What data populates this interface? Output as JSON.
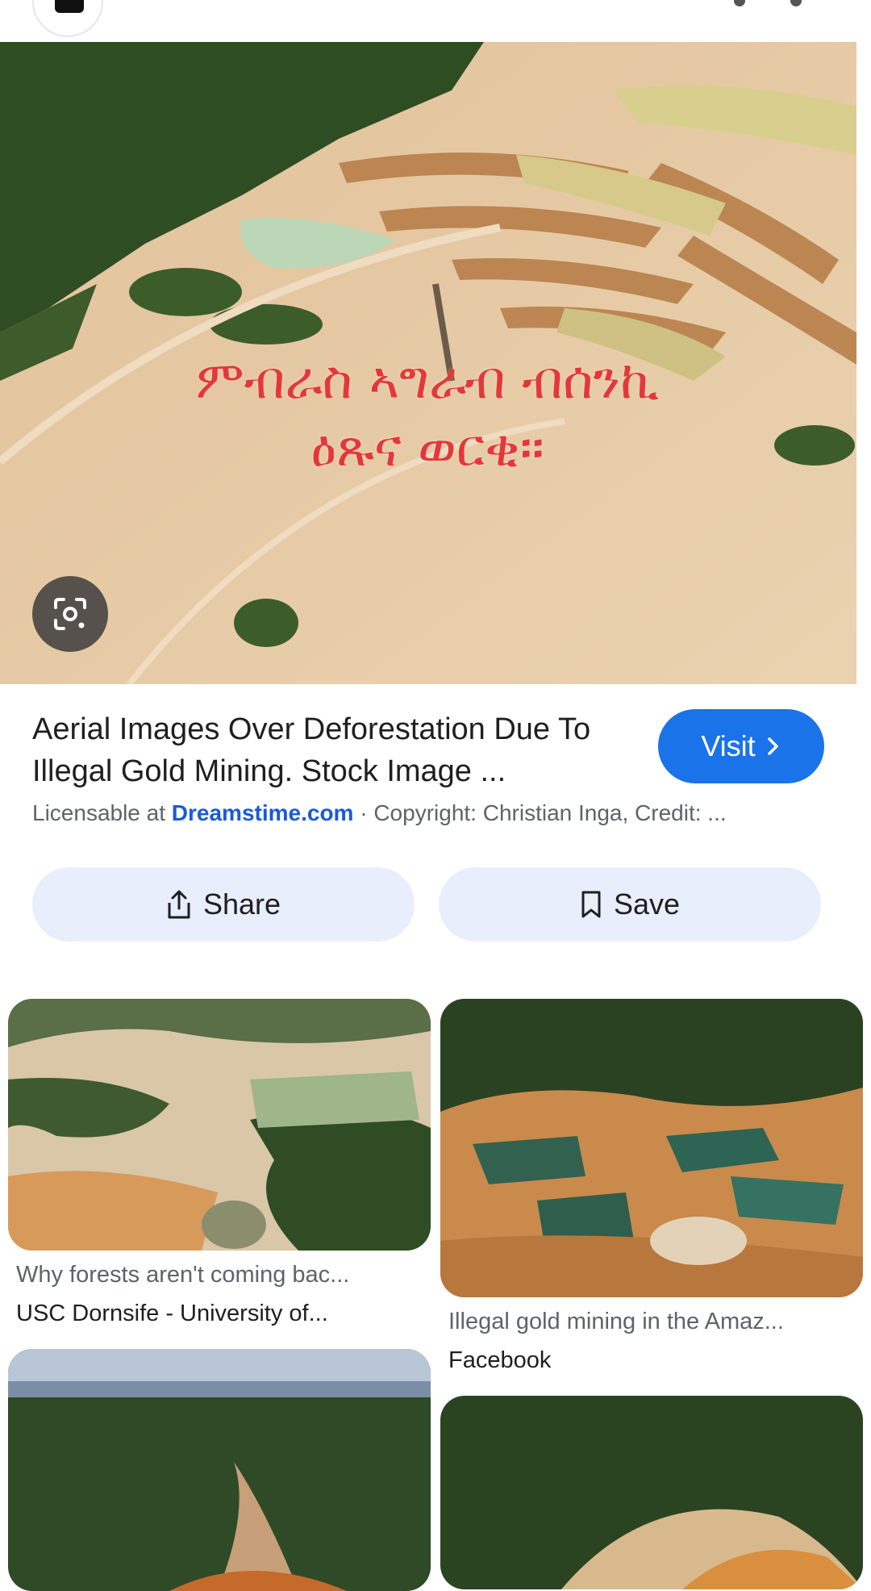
{
  "main": {
    "overlay_line1": "ምብራስ ኣግራብ ብሰንኪ",
    "overlay_line2": "ዕጹና ወርቂ።",
    "title": "Aerial Images Over Deforestation Due To Illegal Gold Mining. Stock Image ...",
    "visit_label": "Visit",
    "source_prefix": "Licensable at",
    "source_link": "Dreamstime.com",
    "source_suffix": "· Copyright: Christian Inga, Credit: ..."
  },
  "actions": {
    "share_label": "Share",
    "save_label": "Save"
  },
  "results": [
    {
      "title": "Why forests aren't coming bac...",
      "source": "USC Dornsife - University of..."
    },
    {
      "title": "Illegal gold mining in the Amaz...",
      "source": "Facebook"
    }
  ],
  "colors": {
    "visit_button": "#1a73e8",
    "pill_background": "#e8eefc",
    "overlay_text": "#e5373a",
    "source_link": "#1a5ad7"
  },
  "icons": {
    "lens": "google-lens-icon",
    "share": "share-icon",
    "save": "bookmark-icon",
    "visit": "chevron-right-icon"
  }
}
